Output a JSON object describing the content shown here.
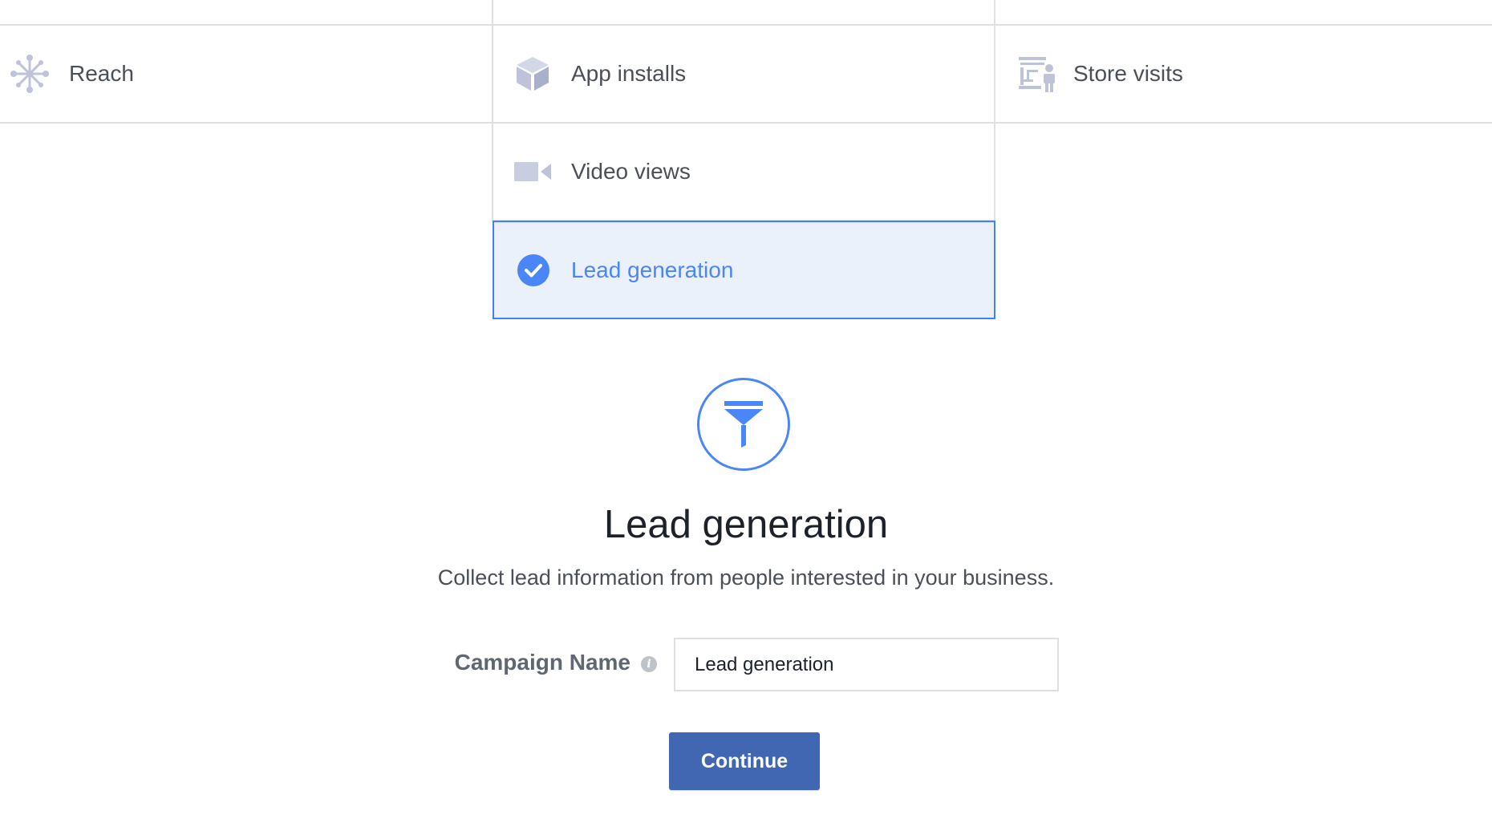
{
  "objectives": {
    "reach": {
      "label": "Reach",
      "icon": "reach-network-icon"
    },
    "app_installs": {
      "label": "App installs",
      "icon": "box-icon"
    },
    "store_visits": {
      "label": "Store visits",
      "icon": "store-person-icon"
    },
    "video_views": {
      "label": "Video views",
      "icon": "video-camera-icon"
    },
    "lead_generation": {
      "label": "Lead generation",
      "icon": "check-circle-icon",
      "selected": true
    }
  },
  "detail": {
    "icon": "funnel-icon",
    "title": "Lead generation",
    "description": "Collect lead information from people interested in your business."
  },
  "form": {
    "campaign_name_label": "Campaign Name",
    "campaign_name_value": "Lead generation",
    "info_icon": "i"
  },
  "actions": {
    "continue_label": "Continue"
  },
  "colors": {
    "accent": "#4a86f7",
    "selected_bg": "#ebf1fa",
    "button": "#4267b2",
    "icon_gray": "#bec3d9",
    "border": "#dddfe2"
  }
}
